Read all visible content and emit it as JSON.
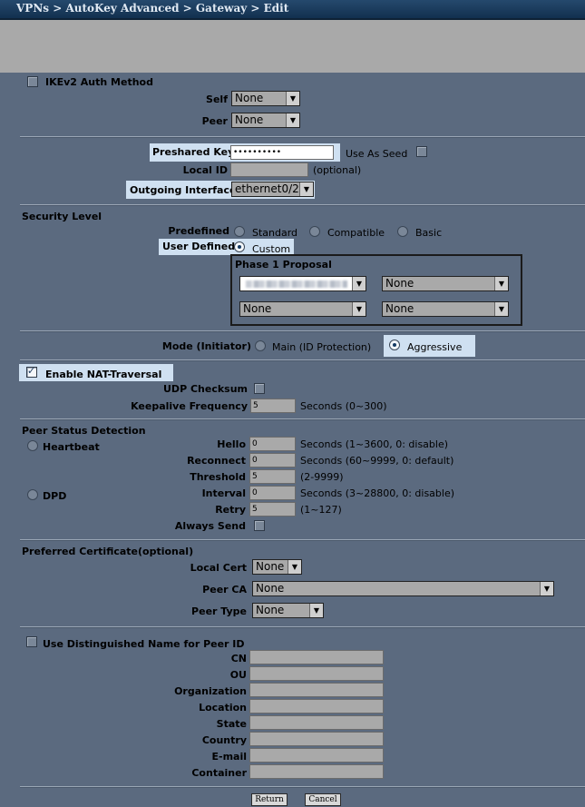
{
  "breadcrumb": "VPNs > AutoKey Advanced > Gateway > Edit",
  "ikev2": {
    "label": "IKEv2 Auth Method",
    "self_label": "Self",
    "self_value": "None",
    "peer_label": "Peer",
    "peer_value": "None"
  },
  "psk": {
    "label": "Preshared Key",
    "value": "••••••••••",
    "seed_label": "Use As Seed"
  },
  "local_id": {
    "label": "Local ID",
    "hint": "(optional)"
  },
  "outgoing": {
    "label": "Outgoing Interface",
    "value": "ethernet0/2"
  },
  "security": {
    "title": "Security Level",
    "predefined_label": "Predefined",
    "options": [
      "Standard",
      "Compatible",
      "Basic"
    ],
    "user_defined_label": "User Defined",
    "custom_label": "Custom"
  },
  "phase1": {
    "title": "Phase 1 Proposal",
    "p2": "None",
    "p3": "None",
    "p4": "None"
  },
  "mode": {
    "label": "Mode (Initiator)",
    "main": "Main (ID Protection)",
    "aggressive": "Aggressive"
  },
  "nat": {
    "label": "Enable NAT-Traversal",
    "udp_label": "UDP Checksum",
    "keepalive_label": "Keepalive Frequency",
    "keepalive_value": "5",
    "keepalive_hint": "Seconds (0~300)"
  },
  "psd": {
    "title": "Peer Status Detection",
    "heartbeat": "Heartbeat",
    "dpd": "DPD",
    "hello": {
      "label": "Hello",
      "value": "0",
      "hint": "Seconds (1~3600, 0: disable)"
    },
    "reconnect": {
      "label": "Reconnect",
      "value": "0",
      "hint": "Seconds (60~9999, 0: default)"
    },
    "threshold": {
      "label": "Threshold",
      "value": "5",
      "hint": "(2-9999)"
    },
    "interval": {
      "label": "Interval",
      "value": "0",
      "hint": "Seconds (3~28800, 0: disable)"
    },
    "retry": {
      "label": "Retry",
      "value": "5",
      "hint": "(1~127)"
    },
    "always_send": "Always Send"
  },
  "cert": {
    "title": "Preferred Certificate(optional)",
    "local_label": "Local Cert",
    "local_value": "None",
    "ca_label": "Peer CA",
    "ca_value": "None",
    "type_label": "Peer Type",
    "type_value": "None"
  },
  "dn": {
    "label": "Use Distinguished Name for Peer ID",
    "fields": [
      "CN",
      "OU",
      "Organization",
      "Location",
      "State",
      "Country",
      "E-mail",
      "Container"
    ]
  },
  "buttons": {
    "return": "Return",
    "cancel": "Cancel"
  }
}
